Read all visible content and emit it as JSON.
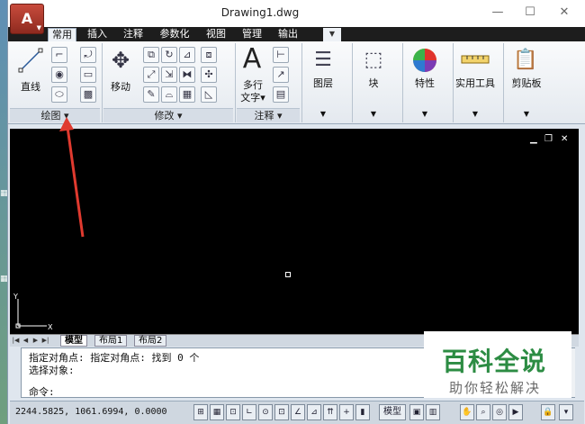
{
  "window": {
    "title": "Drawing1.dwg"
  },
  "app_button": {
    "label": "A"
  },
  "window_controls": {
    "minimize": "—",
    "maximize": "☐",
    "close": "✕"
  },
  "ribbon_tabs": [
    "常用",
    "插入",
    "注释",
    "参数化",
    "视图",
    "管理",
    "输出"
  ],
  "ribbon_tab_extra": "▼",
  "panels": {
    "draw": {
      "title": "绘图 ▾",
      "line_label": "直线"
    },
    "modify": {
      "title": "修改 ▾",
      "move_label": "移动"
    },
    "annotation": {
      "title": "注释 ▾",
      "text_label_1": "多行",
      "text_label_2": "文字▾"
    },
    "layers": {
      "label": "图层"
    },
    "block": {
      "label": "块"
    },
    "properties": {
      "label": "特性"
    },
    "utilities": {
      "label": "实用工具"
    },
    "clipboard": {
      "label": "剪贴板"
    }
  },
  "viewport_controls": {
    "min": "▁",
    "restore": "❐",
    "close": "✕"
  },
  "ucs": {
    "x": "X",
    "y": "Y"
  },
  "layout_tabs": [
    "模型",
    "布局1",
    "布局2"
  ],
  "nav_arrows": [
    "|◀",
    "◀",
    "▶",
    "▶|"
  ],
  "command": {
    "line1": "指定对角点: 指定对角点: 找到 0 个",
    "line2": "选择对象:",
    "prompt": "命令:"
  },
  "status": {
    "coordinates": "2244.5825,  1061.6994, 0.0000",
    "model_label": "模型"
  },
  "watermark": {
    "main": "百科全说",
    "sub": "助你轻松解决"
  },
  "colors": {
    "accent_red": "#e03a2f",
    "watermark_green": "#2c8c43",
    "canvas": "#000000"
  }
}
